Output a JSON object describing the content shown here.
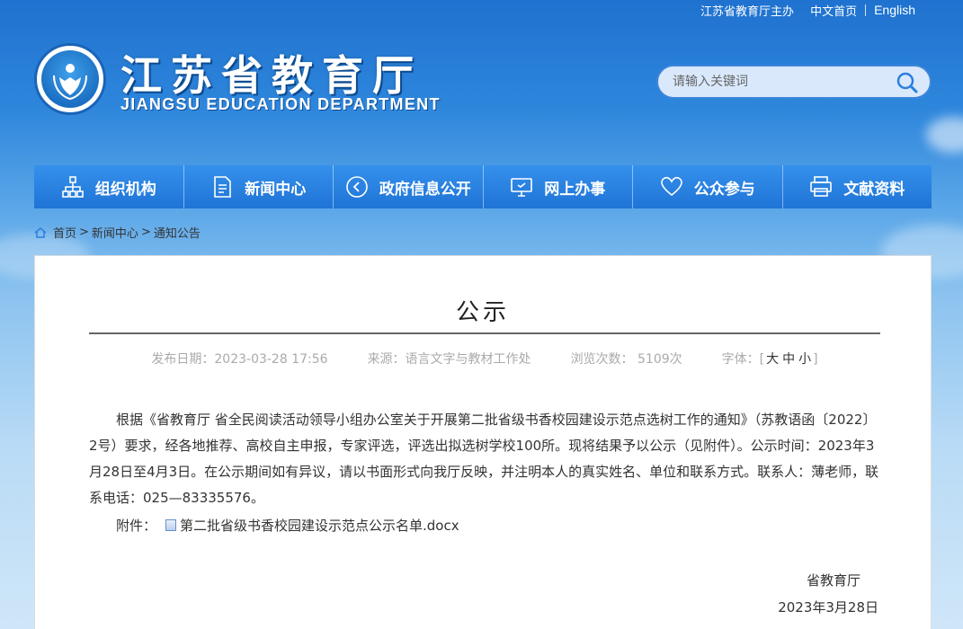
{
  "top_links": {
    "host": "江苏省教育厅主办",
    "chinese": "中文首页",
    "english": "English"
  },
  "header": {
    "title": "江苏省教育厅",
    "subtitle": "JIANGSU EDUCATION DEPARTMENT"
  },
  "search": {
    "placeholder": "请输入关键词",
    "icon": "search-icon"
  },
  "nav": [
    {
      "label": "组织机构",
      "icon": "org-chart-icon"
    },
    {
      "label": "新闻中心",
      "icon": "document-icon"
    },
    {
      "label": "政府信息公开",
      "icon": "play-icon"
    },
    {
      "label": "网上办事",
      "icon": "monitor-icon"
    },
    {
      "label": "公众参与",
      "icon": "heart-icon"
    },
    {
      "label": "文献资料",
      "icon": "printer-icon"
    }
  ],
  "breadcrumb": {
    "home": "首页",
    "level1": "新闻中心",
    "level2": "通知公告",
    "sep": ">"
  },
  "article": {
    "title": "公示",
    "publish_date": "发布日期：2023-03-28 17:56",
    "source": "来源：语言文字与教材工作处",
    "views": "浏览次数： 5109次",
    "font_label": "字体：",
    "font_large": "大",
    "font_medium": "中",
    "font_small": "小",
    "body": "根据《省教育厅 省全民阅读活动领导小组办公室关于开展第二批省级书香校园建设示范点选树工作的通知》（苏教语函〔2022〕2号）要求，经各地推荐、高校自主申报，专家评选，评选出拟选树学校100所。现将结果予以公示（见附件）。公示时间：2023年3月28日至4月3日。在公示期间如有异议，请以书面形式向我厅反映，并注明本人的真实姓名、单位和联系方式。联系人：薄老师，联系电话：025—83335576。",
    "attachment_label": "附件：",
    "attachment_file": "第二批省级书香校园建设示范点公示名单.docx",
    "signature": "省教育厅",
    "date": "2023年3月28日"
  },
  "colors": {
    "nav_bg": "#2a7fe0",
    "header_bg": "#1f72cf"
  }
}
